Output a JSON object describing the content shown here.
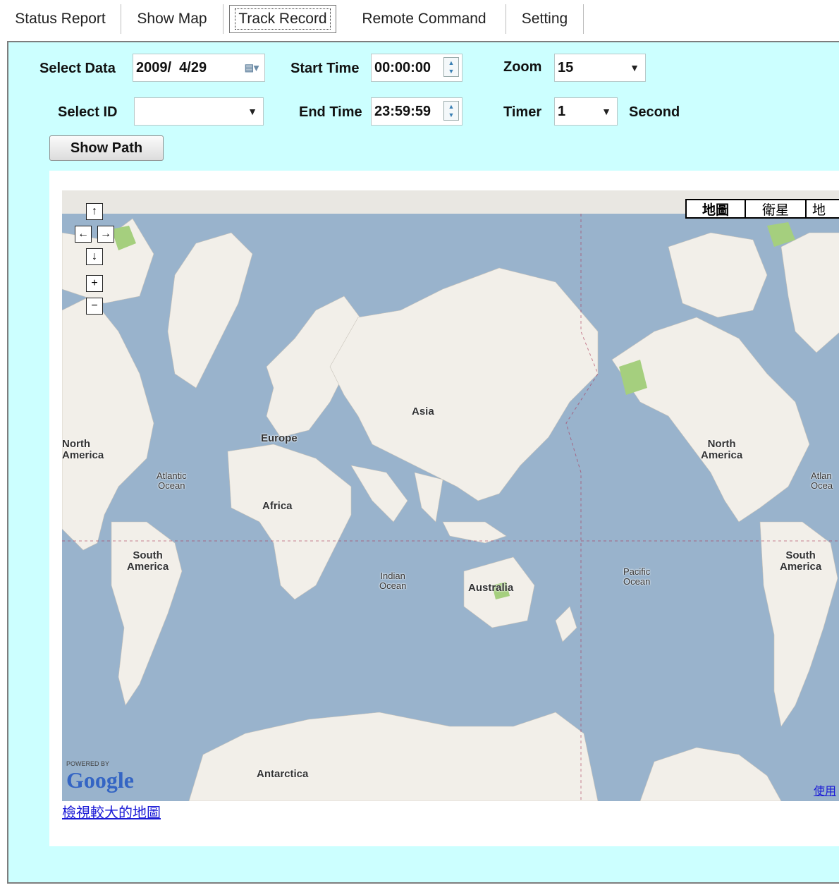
{
  "tabs": [
    {
      "label": "Status Report"
    },
    {
      "label": "Show Map"
    },
    {
      "label": "Track Record"
    },
    {
      "label": "Remote Command"
    },
    {
      "label": "Setting"
    }
  ],
  "form": {
    "select_data_label": "Select Data",
    "select_data_value": "2009/  4/29",
    "start_time_label": "Start Time",
    "start_time_value": "00:00:00",
    "zoom_label": "Zoom",
    "zoom_value": "15",
    "select_id_label": "Select ID",
    "select_id_value": "",
    "end_time_label": "End Time",
    "end_time_value": "23:59:59",
    "timer_label": "Timer",
    "timer_value": "1",
    "timer_unit": "Second",
    "show_path_label": "Show Path"
  },
  "map": {
    "types": [
      "地圖",
      "衛星",
      "地"
    ],
    "labels": {
      "north_america_left": "North\nAmerica",
      "europe": "Europe",
      "asia": "Asia",
      "africa": "Africa",
      "south_america_left": "South\nAmerica",
      "australia": "Australia",
      "antarctica": "Antarctica",
      "north_america_right": "North\nAmerica",
      "south_america_right": "South\nAmerica"
    },
    "ocean_labels": {
      "atlantic": "Atlantic\nOcean",
      "indian": "Indian\nOcean",
      "pacific": "Pacific\nOcean",
      "atlantic_right": "Atlan\nOcea"
    },
    "powered_by": "POWERED BY",
    "google": "Google",
    "terms_partial": "使用",
    "larger_map_link": "檢視較大的地圖"
  },
  "colors": {
    "panel_bg": "#ccffff",
    "ocean": "#99b3cc",
    "land": "#f2efe9",
    "park": "#a5cf7e"
  }
}
